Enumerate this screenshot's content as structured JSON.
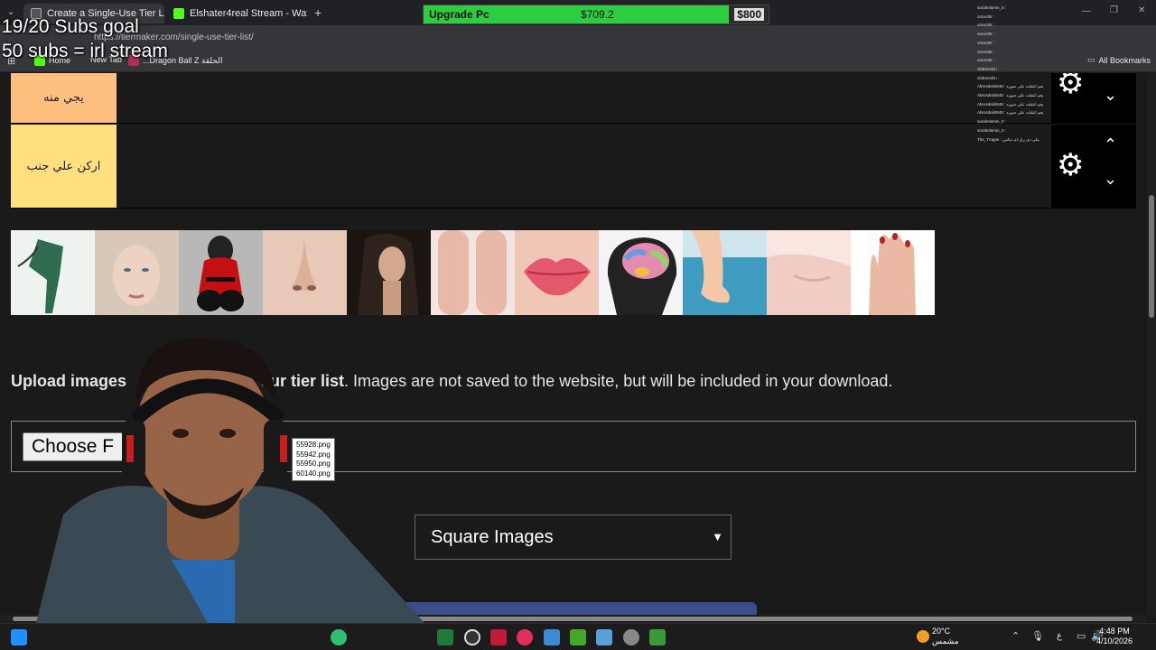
{
  "browser": {
    "tabs": [
      {
        "title": "Create a Single-Use Tier List (P...",
        "active": true
      },
      {
        "title": "Elshater4real Stream - Watch Li...",
        "active": false
      }
    ],
    "url": "https://tiermaker.com/single-use-tier-list/",
    "bookmarks": [
      "Home",
      "New Tab",
      "...Dragon Ball Z الحلقة"
    ],
    "bookmarks_right": "All Bookmarks"
  },
  "overlay": {
    "line1": "19/20 Subs goal",
    "line2": "50 subs = irl stream"
  },
  "upgrade": {
    "label": "Upgrade Pc",
    "current": "$709.2",
    "goal": "$800",
    "progress": 0.886
  },
  "chat": {
    "messages": [
      "sarahelamin_0 :",
      "omar30r :",
      "omar30r :",
      "omar30r :",
      "omar30r :",
      "omar30r :",
      "omar30r :",
      "Gldrenshin :",
      "Gldrenshin :",
      "Abrosdali4848 : يعم انتقلت على صوره",
      "Abrosdali4848 : يعم انتقلت على صوره",
      "Abrosdali4848 : يعم انتقلت على صوره",
      "Abrosdali4848 : يعم انتقلت على صوره",
      "sarahelamin_0 :",
      "sarahelamin_0 :",
      "The_Trogan : ملی دی ريل ام ديكس"
    ]
  },
  "tiers": [
    {
      "label": "يجي منه",
      "color": "#ffbf7f"
    },
    {
      "label": "اركن علي جنب",
      "color": "#ffdf80"
    }
  ],
  "pool": {
    "images": [
      "leg-cartoon",
      "face",
      "incredibles-back",
      "nose",
      "woman-hair",
      "knees",
      "lips",
      "brain",
      "foot-pool",
      "armpit",
      "hand"
    ]
  },
  "upload": {
    "bold_start": "Upload images",
    "bold_end": "our tier list",
    "rest": ". Images are not saved to the website, but will be included in your download.",
    "button_label": "Choose F",
    "file_list": [
      "55928.png",
      "55942.png",
      "55950.png",
      "60140.png"
    ]
  },
  "image_shape": {
    "selected": "Square Images"
  },
  "taskbar": {
    "weather_temp": "20°C",
    "weather_desc": "مشمس",
    "time": "4:48 PM",
    "date": "4/10/2026",
    "lang": "ع"
  }
}
